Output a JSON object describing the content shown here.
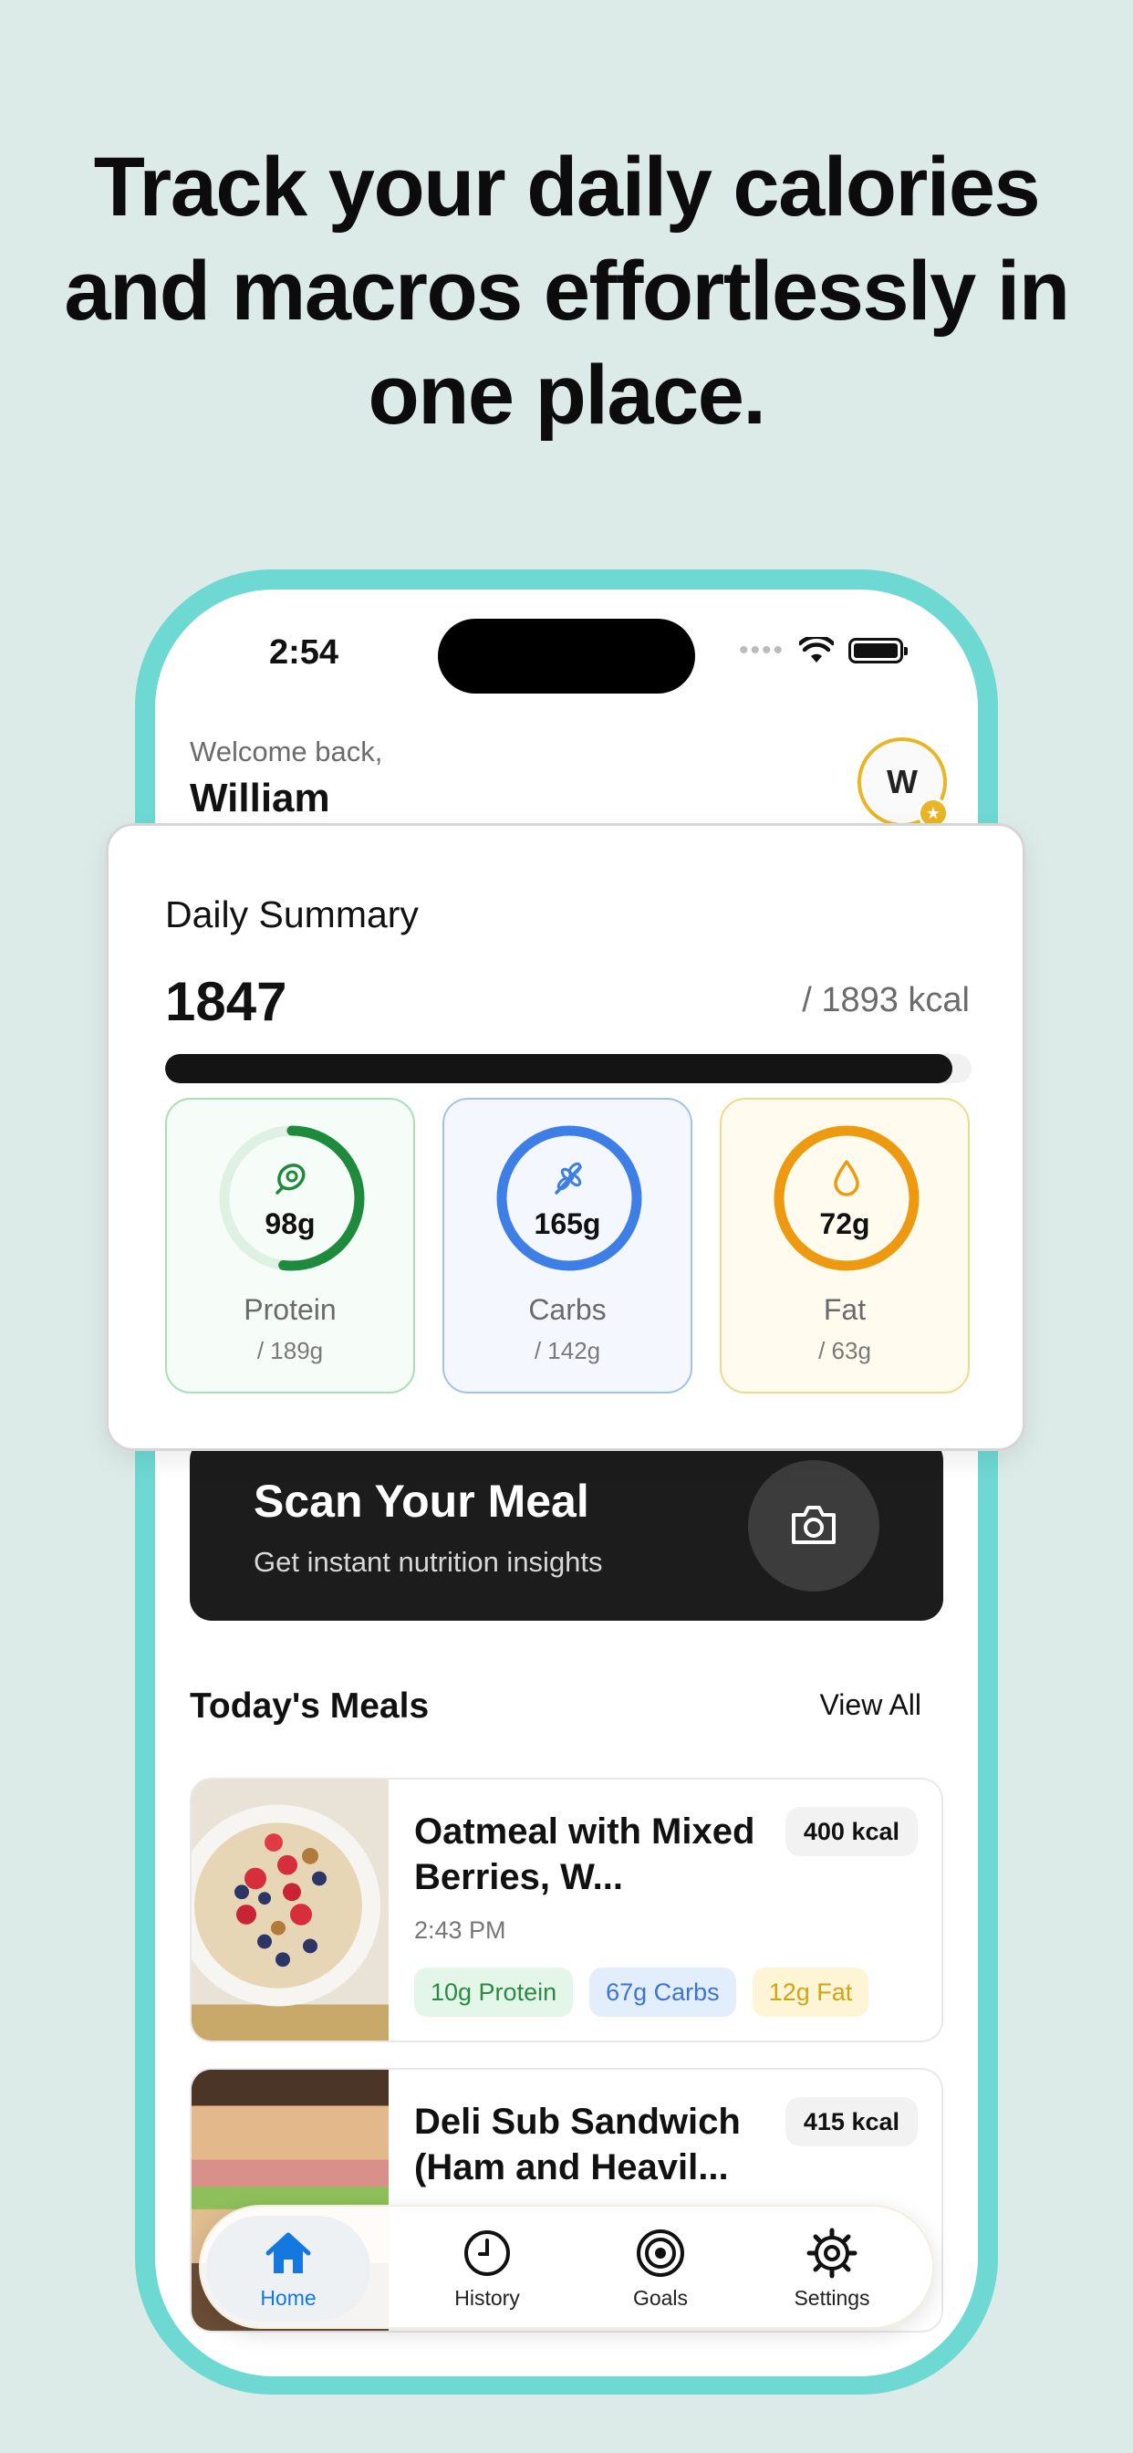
{
  "headline": "Track your daily calories and macros effortlessly in one place.",
  "status_bar": {
    "time": "2:54"
  },
  "header": {
    "welcome": "Welcome back,",
    "name": "William",
    "avatar_initial": "W"
  },
  "summary": {
    "title": "Daily Summary",
    "calories_current": "1847",
    "calories_goal": "/ 1893 kcal",
    "progress_fraction": 0.976,
    "macros": [
      {
        "label": "Protein",
        "value": "98g",
        "goal": "/ 189g",
        "fraction": 0.52,
        "color": "#1e8a3c",
        "track": "#dff1e3",
        "icon": "meat-icon"
      },
      {
        "label": "Carbs",
        "value": "165g",
        "goal": "/ 142g",
        "fraction": 1.0,
        "color": "#3d7fe6",
        "track": "#dbe8fb",
        "icon": "wheat-icon"
      },
      {
        "label": "Fat",
        "value": "72g",
        "goal": "/ 63g",
        "fraction": 1.0,
        "color": "#ee9a10",
        "track": "#fbe9c6",
        "icon": "drop-icon"
      }
    ]
  },
  "scan": {
    "title": "Scan Your Meal",
    "subtitle": "Get instant nutrition insights",
    "icon": "camera-icon"
  },
  "meals": {
    "title": "Today's Meals",
    "view_all": "View All",
    "items": [
      {
        "name": "Oatmeal with Mixed Berries, W...",
        "kcal": "400 kcal",
        "time": "2:43 PM",
        "protein": "10g Protein",
        "carbs": "67g Carbs",
        "fat": "12g Fat"
      },
      {
        "name": "Deli Sub Sandwich (Ham and Heavil...",
        "kcal": "415 kcal"
      }
    ]
  },
  "tabbar": {
    "tabs": [
      {
        "label": "Home",
        "icon": "home-icon"
      },
      {
        "label": "History",
        "icon": "clock-icon"
      },
      {
        "label": "Goals",
        "icon": "target-icon"
      },
      {
        "label": "Settings",
        "icon": "gear-icon"
      }
    ]
  },
  "colors": {
    "frame": "#6ed8d2",
    "background": "#dceae8",
    "accent": "#1478e0"
  }
}
